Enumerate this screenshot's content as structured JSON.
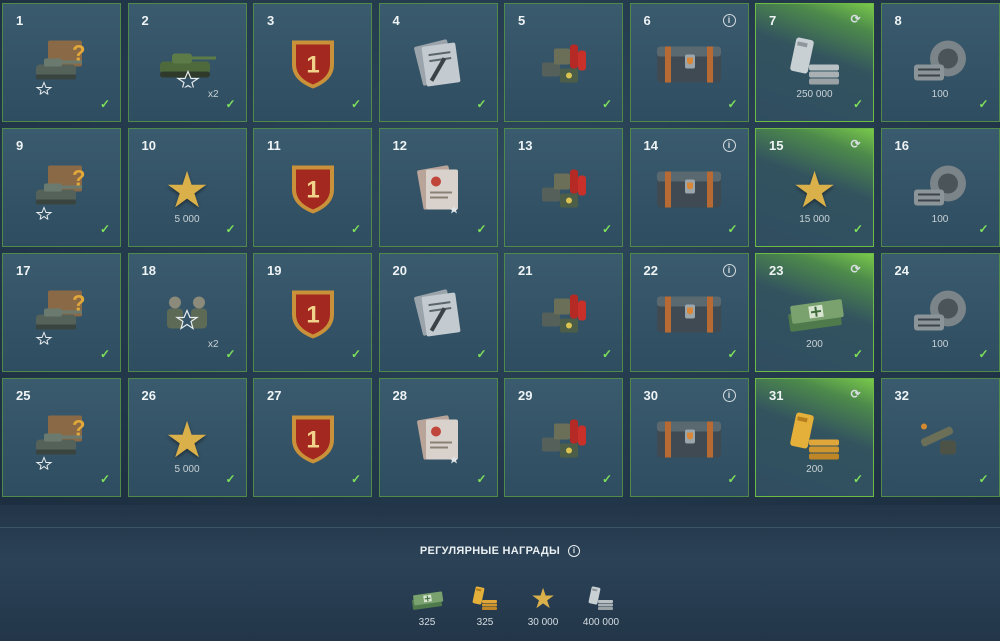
{
  "grid": {
    "tiles": [
      {
        "num": "1",
        "kind": "mystery-tank",
        "icon": "mystery-tank-icon"
      },
      {
        "num": "2",
        "kind": "tank",
        "icon": "tank-icon",
        "mult": "x2"
      },
      {
        "num": "3",
        "kind": "medal",
        "icon": "rank-medal-icon"
      },
      {
        "num": "4",
        "kind": "documents",
        "icon": "documents-icon"
      },
      {
        "num": "5",
        "kind": "consumables",
        "icon": "consumables-icon"
      },
      {
        "num": "6",
        "kind": "chest",
        "icon": "chest-icon",
        "corner": "info"
      },
      {
        "num": "7",
        "kind": "silver",
        "icon": "silver-icon",
        "amount": "250 000",
        "corner": "refresh",
        "highlight": true
      },
      {
        "num": "8",
        "kind": "boosters",
        "icon": "boosters-icon",
        "amount": "100"
      },
      {
        "num": "9",
        "kind": "mystery-tank",
        "icon": "mystery-tank-icon"
      },
      {
        "num": "10",
        "kind": "star",
        "icon": "star-icon",
        "amount": "5 000"
      },
      {
        "num": "11",
        "kind": "medal",
        "icon": "rank-medal-icon"
      },
      {
        "num": "12",
        "kind": "papers",
        "icon": "papers-icon"
      },
      {
        "num": "13",
        "kind": "consumables",
        "icon": "consumables-icon"
      },
      {
        "num": "14",
        "kind": "chest",
        "icon": "chest-icon",
        "corner": "info"
      },
      {
        "num": "15",
        "kind": "star",
        "icon": "star-icon",
        "amount": "15 000",
        "corner": "refresh",
        "highlight": true
      },
      {
        "num": "16",
        "kind": "boosters",
        "icon": "boosters-icon",
        "amount": "100"
      },
      {
        "num": "17",
        "kind": "mystery-tank",
        "icon": "mystery-tank-icon"
      },
      {
        "num": "18",
        "kind": "crew",
        "icon": "crew-icon",
        "mult": "x2"
      },
      {
        "num": "19",
        "kind": "medal",
        "icon": "rank-medal-icon"
      },
      {
        "num": "20",
        "kind": "documents",
        "icon": "documents-icon"
      },
      {
        "num": "21",
        "kind": "consumables",
        "icon": "consumables-icon"
      },
      {
        "num": "22",
        "kind": "chest",
        "icon": "chest-icon",
        "corner": "info"
      },
      {
        "num": "23",
        "kind": "cash",
        "icon": "cash-icon",
        "amount": "200",
        "corner": "refresh",
        "highlight": true
      },
      {
        "num": "24",
        "kind": "boosters",
        "icon": "boosters-icon",
        "amount": "100"
      },
      {
        "num": "25",
        "kind": "mystery-tank",
        "icon": "mystery-tank-icon"
      },
      {
        "num": "26",
        "kind": "star",
        "icon": "star-icon",
        "amount": "5 000"
      },
      {
        "num": "27",
        "kind": "medal",
        "icon": "rank-medal-icon"
      },
      {
        "num": "28",
        "kind": "papers",
        "icon": "papers-icon"
      },
      {
        "num": "29",
        "kind": "consumables",
        "icon": "consumables-icon"
      },
      {
        "num": "30",
        "kind": "chest",
        "icon": "chest-icon",
        "corner": "info"
      },
      {
        "num": "31",
        "kind": "gold",
        "icon": "gold-icon",
        "amount": "200",
        "corner": "refresh",
        "highlight": true
      },
      {
        "num": "32",
        "kind": "gun",
        "icon": "gun-icon"
      }
    ],
    "check_glyph": "✓",
    "medal_label": "1",
    "colors": {
      "check": "#7ee05a",
      "highlight": "#79c84b",
      "border": "#4f8a4a"
    }
  },
  "footer": {
    "title": "РЕГУЛЯРНЫЕ НАГРАДЫ",
    "info_glyph": "i",
    "rewards": [
      {
        "icon": "cash-icon",
        "value": "325"
      },
      {
        "icon": "gold-icon",
        "value": "325"
      },
      {
        "icon": "star-icon",
        "value": "30 000"
      },
      {
        "icon": "silver-icon",
        "value": "400 000"
      }
    ]
  }
}
